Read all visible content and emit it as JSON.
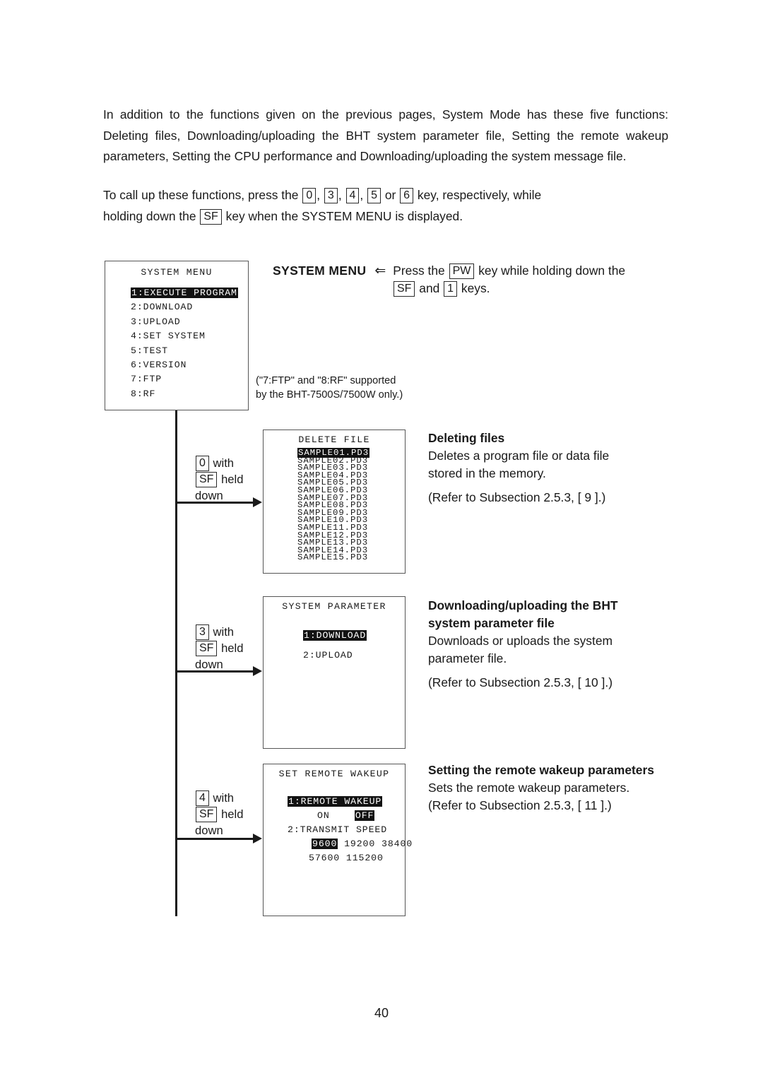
{
  "page": {
    "number": "40"
  },
  "intro": {
    "paragraph1": "In addition to the functions given on the previous pages, System Mode has these five functions: Deleting files, Downloading/uploading the BHT system parameter file, Setting the remote wakeup parameters, Setting the CPU performance and Downloading/uploading the system message file.",
    "paragraph2": {
      "line1_before": "To call up these functions, press the",
      "keys": [
        "0",
        "3",
        "4",
        "5",
        "6"
      ],
      "sep": ",",
      "or_word": "or",
      "line1_after": "key, respectively, while",
      "line2_before": "holding down the",
      "sf_key": "SF",
      "line2_after": "key when the SYSTEM MENU is displayed."
    }
  },
  "system_menu_screen": {
    "title": "SYSTEM MENU",
    "items": [
      {
        "label": "1:EXECUTE PROGRAM",
        "highlighted": true
      },
      {
        "label": "2:DOWNLOAD",
        "highlighted": false
      },
      {
        "label": "3:UPLOAD",
        "highlighted": false
      },
      {
        "label": "4:SET SYSTEM",
        "highlighted": false
      },
      {
        "label": "5:TEST",
        "highlighted": false
      },
      {
        "label": "6:VERSION",
        "highlighted": false
      },
      {
        "label": "7:FTP",
        "highlighted": false
      },
      {
        "label": "8:RF",
        "highlighted": false
      }
    ]
  },
  "system_menu_callout": {
    "title": "SYSTEM MENU",
    "arrow": "⇐",
    "line1_before": "Press the",
    "pw_key": "PW",
    "line1_after": "key while holding down the",
    "line2_sf": "SF",
    "line2_and": "and",
    "line2_one": "1",
    "line2_after": "keys."
  },
  "ftp_note": {
    "line1": "(\"7:FTP\" and \"8:RF\" supported",
    "line2": "by the BHT-7500S/7500W only.)"
  },
  "branches": [
    {
      "key": "0",
      "with_word": "with",
      "sf_key": "SF",
      "held_word": "held",
      "down_word": "down"
    },
    {
      "key": "3",
      "with_word": "with",
      "sf_key": "SF",
      "held_word": "held",
      "down_word": "down"
    },
    {
      "key": "4",
      "with_word": "with",
      "sf_key": "SF",
      "held_word": "held",
      "down_word": "down"
    }
  ],
  "delete_file_screen": {
    "title": "DELETE FILE",
    "files": [
      {
        "name": "SAMPLE01.PD3",
        "highlighted": true
      },
      {
        "name": "SAMPLE02.PD3",
        "highlighted": false
      },
      {
        "name": "SAMPLE03.PD3",
        "highlighted": false
      },
      {
        "name": "SAMPLE04.PD3",
        "highlighted": false
      },
      {
        "name": "SAMPLE05.PD3",
        "highlighted": false
      },
      {
        "name": "SAMPLE06.PD3",
        "highlighted": false
      },
      {
        "name": "SAMPLE07.PD3",
        "highlighted": false
      },
      {
        "name": "SAMPLE08.PD3",
        "highlighted": false
      },
      {
        "name": "SAMPLE09.PD3",
        "highlighted": false
      },
      {
        "name": "SAMPLE10.PD3",
        "highlighted": false
      },
      {
        "name": "SAMPLE11.PD3",
        "highlighted": false
      },
      {
        "name": "SAMPLE12.PD3",
        "highlighted": false
      },
      {
        "name": "SAMPLE13.PD3",
        "highlighted": false
      },
      {
        "name": "SAMPLE14.PD3",
        "highlighted": false
      },
      {
        "name": "SAMPLE15.PD3",
        "highlighted": false
      }
    ]
  },
  "delete_file_callout": {
    "heading": "Deleting files",
    "body_line1": "Deletes a program file or data file",
    "body_line2": "stored in the memory.",
    "reference": "(Refer to Subsection 2.5.3, [ 9 ].)"
  },
  "system_parameter_screen": {
    "title": "SYSTEM PARAMETER",
    "items": [
      {
        "label": "1:DOWNLOAD",
        "highlighted": true
      },
      {
        "label": "2:UPLOAD",
        "highlighted": false
      }
    ]
  },
  "system_parameter_callout": {
    "heading_line1": "Downloading/uploading the BHT",
    "heading_line2": "system parameter file",
    "body_line1": "Downloads or uploads the system",
    "body_line2": "parameter file.",
    "reference": "(Refer to Subsection 2.5.3, [ 10 ].)"
  },
  "remote_wakeup_screen": {
    "title": "SET REMOTE WAKEUP",
    "option1_label": "1:REMOTE WAKEUP",
    "option1_highlighted": true,
    "on_label": "ON",
    "off_label": "OFF",
    "off_highlighted": true,
    "option2_label": "2:TRANSMIT SPEED",
    "speeds_row1": [
      {
        "value": "9600",
        "highlighted": true
      },
      {
        "value": "19200",
        "highlighted": false
      },
      {
        "value": "38400",
        "highlighted": false
      }
    ],
    "speeds_row2": [
      {
        "value": "57600",
        "highlighted": false
      },
      {
        "value": "115200",
        "highlighted": false
      }
    ]
  },
  "remote_wakeup_callout": {
    "heading": "Setting the remote wakeup parameters",
    "body_line1": "Sets the remote wakeup parameters.",
    "reference": "(Refer to Subsection 2.5.3, [ 11 ].)"
  }
}
